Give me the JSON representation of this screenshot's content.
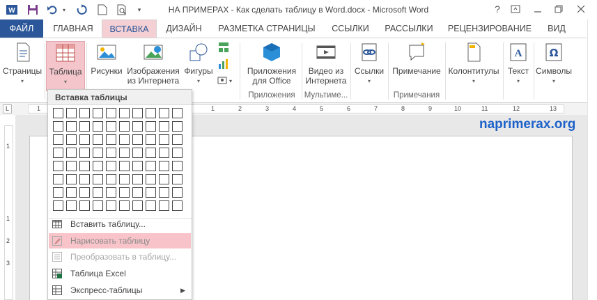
{
  "window": {
    "title": "НА ПРИМЕРАХ - Как сделать таблицу в Word.docx - Microsoft Word",
    "help": "?"
  },
  "tabs": [
    {
      "label": "ФАЙЛ"
    },
    {
      "label": "ГЛАВНАЯ"
    },
    {
      "label": "ВСТАВКА"
    },
    {
      "label": "ДИЗАЙН"
    },
    {
      "label": "РАЗМЕТКА СТРАНИЦЫ"
    },
    {
      "label": "ССЫЛКИ"
    },
    {
      "label": "РАССЫЛКИ"
    },
    {
      "label": "РЕЦЕНЗИРОВАНИЕ"
    },
    {
      "label": "ВИД"
    }
  ],
  "ribbon": {
    "pages": "Страницы",
    "table": "Таблица",
    "pictures": "Рисунки",
    "online_pictures_1": "Изображения",
    "online_pictures_2": "из Интернета",
    "shapes": "Фигуры",
    "apps_1": "Приложения",
    "apps_2": "для Office",
    "video_1": "Видео из",
    "video_2": "Интернета",
    "links": "Ссылки",
    "comment": "Примечание",
    "header_footer": "Колонтитулы",
    "text": "Текст",
    "symbols": "Символы",
    "group_apps": "Приложения",
    "group_media": "Мультиме...",
    "group_comments": "Примечания"
  },
  "ruler": {
    "corner": "L",
    "numbers": [
      "1",
      "1",
      "2",
      "3",
      "4",
      "5",
      "6",
      "7",
      "8",
      "9",
      "10",
      "11",
      "12",
      "13"
    ],
    "vnumbers": [
      "1",
      "1",
      "2",
      "3"
    ]
  },
  "watermark": "naprimerax.org",
  "dropdown": {
    "header": "Вставка таблицы",
    "grid_cols": 10,
    "grid_rows": 8,
    "items": [
      {
        "label": "Вставить таблицу..."
      },
      {
        "label": "Нарисовать таблицу"
      },
      {
        "label": "Преобразовать в таблицу..."
      },
      {
        "label": "Таблица Excel"
      },
      {
        "label": "Экспресс-таблицы"
      }
    ]
  },
  "colors": {
    "file_tab": "#2b579a",
    "accent": "#2b579a",
    "highlight": "#f8c4c9",
    "watermark": "#1e62c9"
  }
}
